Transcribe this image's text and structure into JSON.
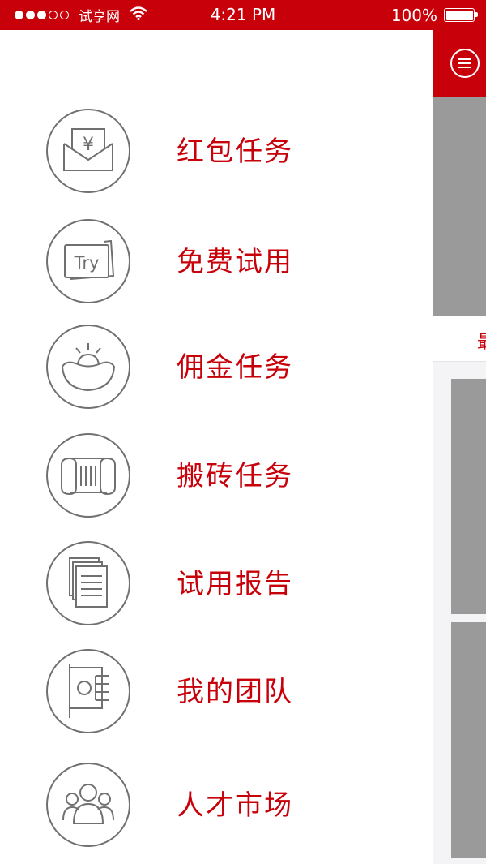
{
  "status_bar": {
    "carrier": "试享网",
    "time": "4:21 PM",
    "battery": "100%"
  },
  "menu": {
    "items": [
      {
        "label": "红包任务",
        "icon": "red-envelope-icon"
      },
      {
        "label": "免费试用",
        "icon": "try-cards-icon"
      },
      {
        "label": "佣金任务",
        "icon": "gold-ingot-icon"
      },
      {
        "label": "搬砖任务",
        "icon": "scroll-icon"
      },
      {
        "label": "试用报告",
        "icon": "documents-icon"
      },
      {
        "label": "我的团队",
        "icon": "team-flag-icon"
      },
      {
        "label": "人才市场",
        "icon": "people-group-icon"
      }
    ]
  },
  "icon_text": {
    "yen": "¥",
    "try": "Try"
  },
  "peek": {
    "tab_glyph": "最"
  },
  "colors": {
    "brand_red": "#c8000a",
    "icon_stroke": "#707070",
    "placeholder_gray": "#9a9a9a",
    "content_bg": "#f4f4f6"
  }
}
